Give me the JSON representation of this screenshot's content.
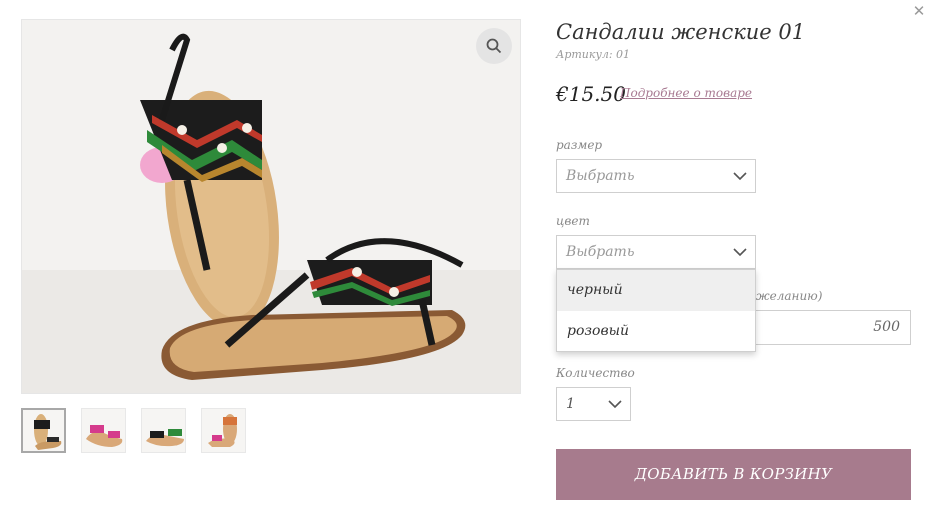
{
  "product": {
    "title": "Сандалии женские 01",
    "sku": "Артикул: 01",
    "price": "€15.50",
    "details_link": "Подробнее о товаре"
  },
  "gallery": {
    "thumbnails": 4,
    "active_index": 0
  },
  "options": {
    "size": {
      "label": "размер",
      "placeholder": "Выбрать"
    },
    "color": {
      "label": "цвет",
      "placeholder": "Выбрать",
      "dropdown_open": true,
      "items": [
        "черный",
        "розовый"
      ]
    },
    "partial_label": "желанию)",
    "amount_value": "500",
    "quantity": {
      "label": "Количество",
      "value": "1"
    }
  },
  "add_to_cart": "ДОБАВИТЬ В КОРЗИНУ",
  "colors": {
    "accent": "#a77b8d",
    "link": "#a87a92",
    "zoom_bg": "#e4e4e4"
  },
  "icons": [
    "close-icon",
    "zoom-icon",
    "chevron-down-icon"
  ]
}
